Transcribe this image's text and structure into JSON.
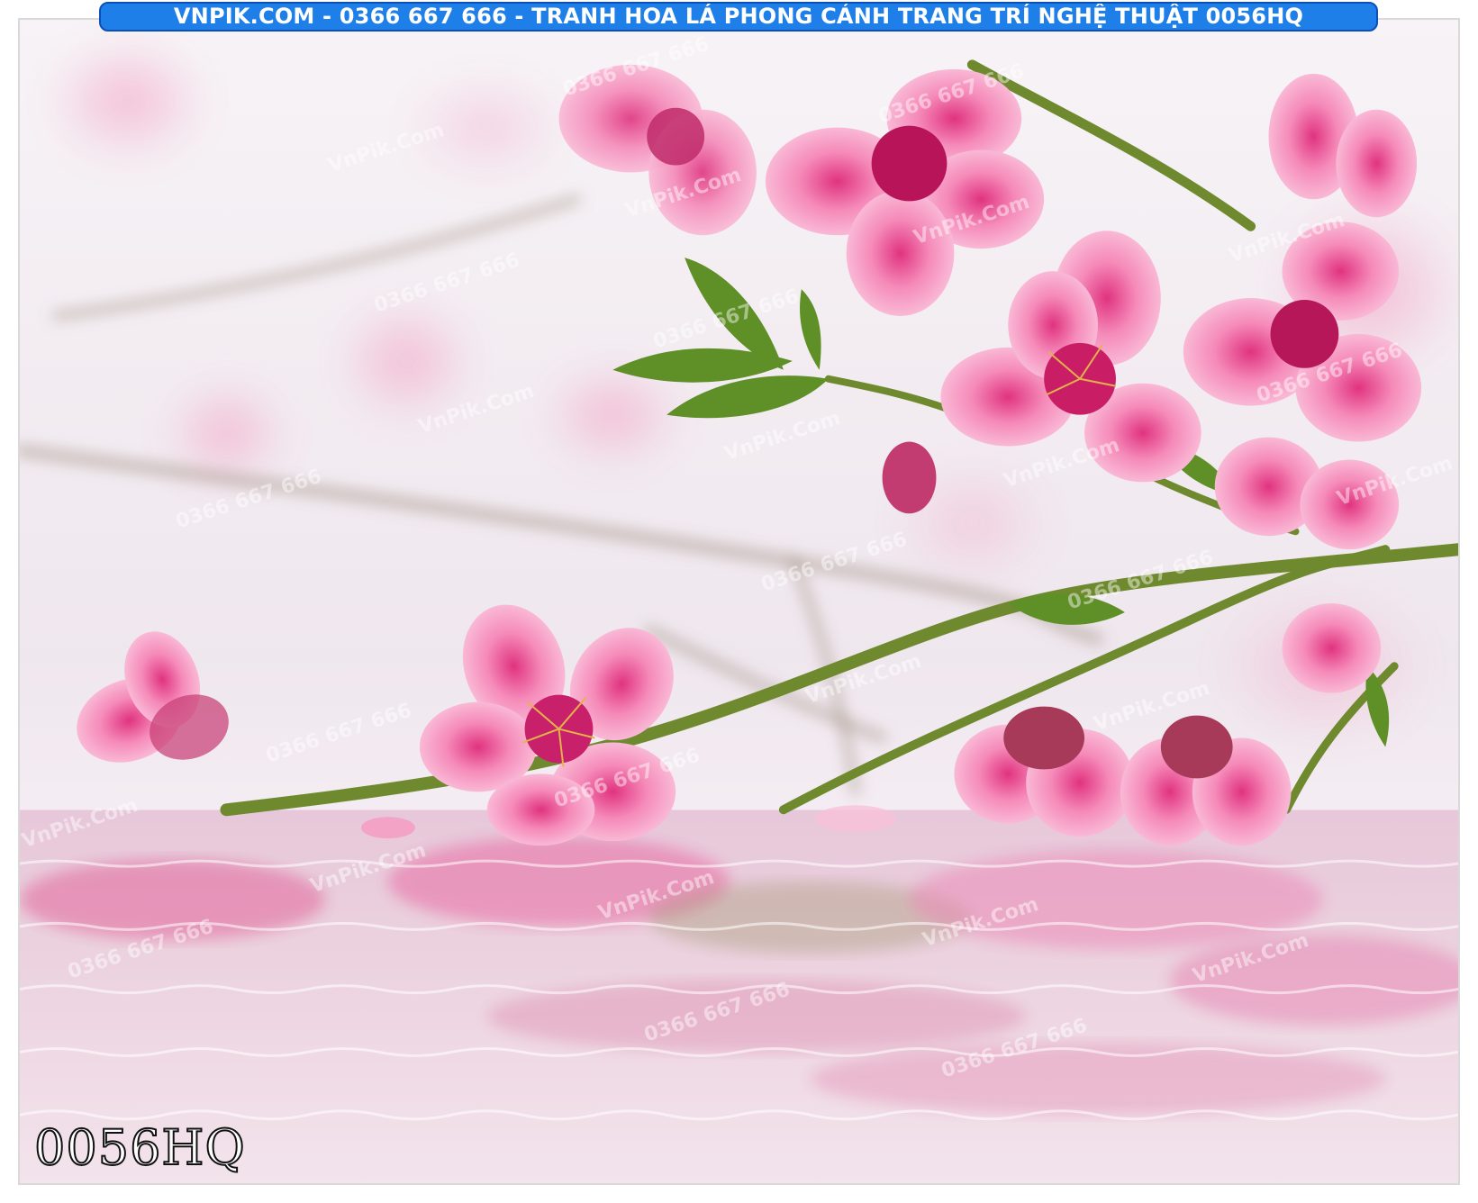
{
  "banner": {
    "title": "VNPIK.COM - 0366 667 666 - TRANH HOA LÁ PHONG CẢNH TRANG TRÍ NGHỆ THUẬT 0056HQ"
  },
  "stamp": {
    "code": "0056HQ"
  },
  "watermarks": {
    "site": "VnPik.Com",
    "phone": "0366 667 666"
  },
  "colors": {
    "banner_bg": "#1f7fe8",
    "blossom_pink": "#f06aa8",
    "stem_green": "#6a8a2c",
    "water": "#e9d6e2"
  },
  "scene": {
    "subject": "pink-peach-blossom-branch-over-water"
  }
}
